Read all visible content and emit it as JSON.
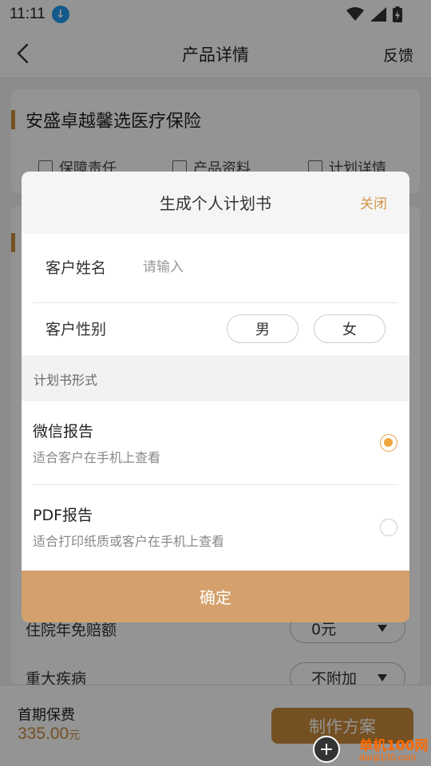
{
  "status_bar": {
    "time": "11:11",
    "download_icon": "download-icon",
    "wifi_icon": "wifi-icon",
    "signal_icon": "signal-icon",
    "battery_icon": "battery-charging-icon"
  },
  "nav": {
    "title": "产品详情",
    "feedback": "反馈",
    "back_icon": "chevron-left-icon"
  },
  "product": {
    "name": "安盛卓越馨选医疗保险",
    "tabs": [
      {
        "label": "保障责任",
        "icon": "document-icon"
      },
      {
        "label": "产品资料",
        "icon": "box-icon"
      },
      {
        "label": "计划详情",
        "icon": "book-icon"
      }
    ]
  },
  "background_rows": [
    {
      "label": "住院年免赔额",
      "value": "0元"
    },
    {
      "label": "重大疾病",
      "value": "不附加"
    }
  ],
  "bottom": {
    "premium_label": "首期保费",
    "premium_value": "335.00",
    "premium_unit": "元",
    "make_plan": "制作方案"
  },
  "dialog": {
    "title": "生成个人计划书",
    "close": "关闭",
    "name_label": "客户姓名",
    "name_placeholder": "请输入",
    "name_value": "",
    "gender_label": "客户性别",
    "gender_options": [
      "男",
      "女"
    ],
    "format_section": "计划书形式",
    "options": [
      {
        "title": "微信报告",
        "desc": "适合客户在手机上查看",
        "selected": true
      },
      {
        "title": "PDF报告",
        "desc": "适合打印纸质或客户在手机上查看",
        "selected": false
      }
    ],
    "confirm": "确定"
  },
  "colors": {
    "accent": "#c98a3c",
    "confirm_bg": "#d4a06c",
    "radio_checked": "#f0a63e",
    "close_text": "#d39346"
  },
  "watermark": {
    "text1": "单机100网",
    "text2": "danji100.com",
    "logo_icon": "plus-circle-logo-icon"
  }
}
